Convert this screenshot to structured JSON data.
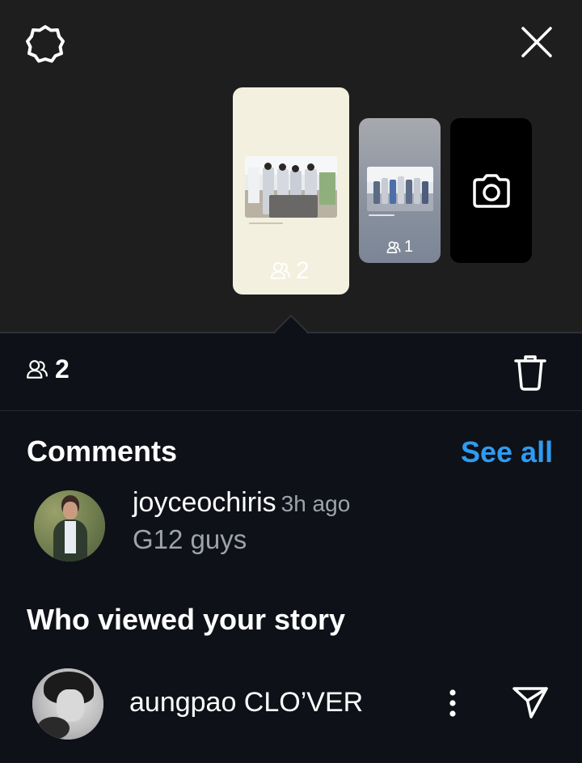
{
  "top_bar": {
    "settings_icon": "settings-gear-icon",
    "close_icon": "close-x-icon"
  },
  "stories": [
    {
      "viewer_count": "2",
      "selected": true
    },
    {
      "viewer_count": "1",
      "selected": false
    },
    {
      "type": "camera",
      "icon": "camera-icon"
    }
  ],
  "stats": {
    "viewer_count": "2",
    "viewers_icon": "people-icon",
    "delete_icon": "trash-icon"
  },
  "comments": {
    "title": "Comments",
    "see_all_label": "See all",
    "items": [
      {
        "username": "joyceochiris",
        "time": "3h ago",
        "text": "G12 guys"
      }
    ]
  },
  "viewers": {
    "title": "Who viewed your story",
    "items": [
      {
        "name": "aungpao CLO’VER",
        "more_icon": "more-vertical-icon",
        "send_icon": "send-icon"
      }
    ]
  },
  "colors": {
    "background": "#0e1117",
    "top_background": "#1e1e1e",
    "accent_link": "#2f9bf0",
    "secondary_text": "#9ea3aa"
  }
}
